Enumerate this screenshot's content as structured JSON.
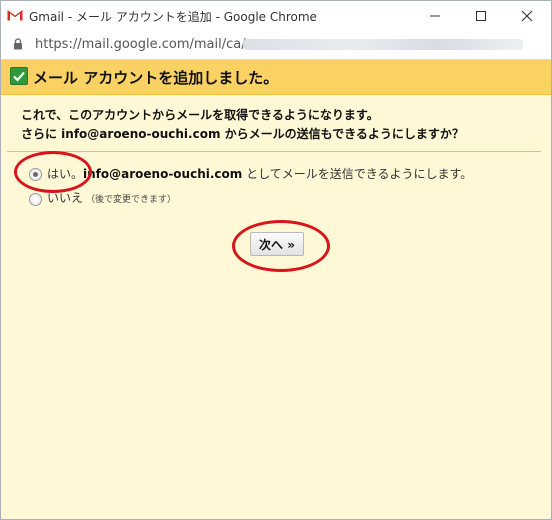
{
  "window": {
    "title": "Gmail - メール アカウントを追加 - Google Chrome",
    "app_icon": "gmail-logo-icon",
    "controls": [
      "minimize-icon",
      "maximize-icon",
      "close-icon"
    ]
  },
  "address_bar": {
    "url": "https://mail.google.com/mail/ca/",
    "lock_icon": "lock-icon"
  },
  "dialog": {
    "title": "メール アカウントを追加しました。",
    "description_line1": "これで、このアカウントからメールを取得できるようになります。",
    "description_line2": "さらに info@aroeno-ouchi.com からメールの送信もできるようにしますか？",
    "options": [
      {
        "label_prefix": "はい。",
        "email": "info@aroeno-ouchi.com",
        "label_suffix": " としてメールを送信できるようにします。",
        "selected": true
      },
      {
        "label": "いいえ",
        "note": "（後で変更できます）",
        "selected": false
      }
    ],
    "next_button": "次へ »"
  },
  "colors": {
    "header_bg": "#fad163",
    "page_bg": "#fff8d7",
    "check_green": "#2e9a3a",
    "annotation_red": "#d9141a"
  }
}
